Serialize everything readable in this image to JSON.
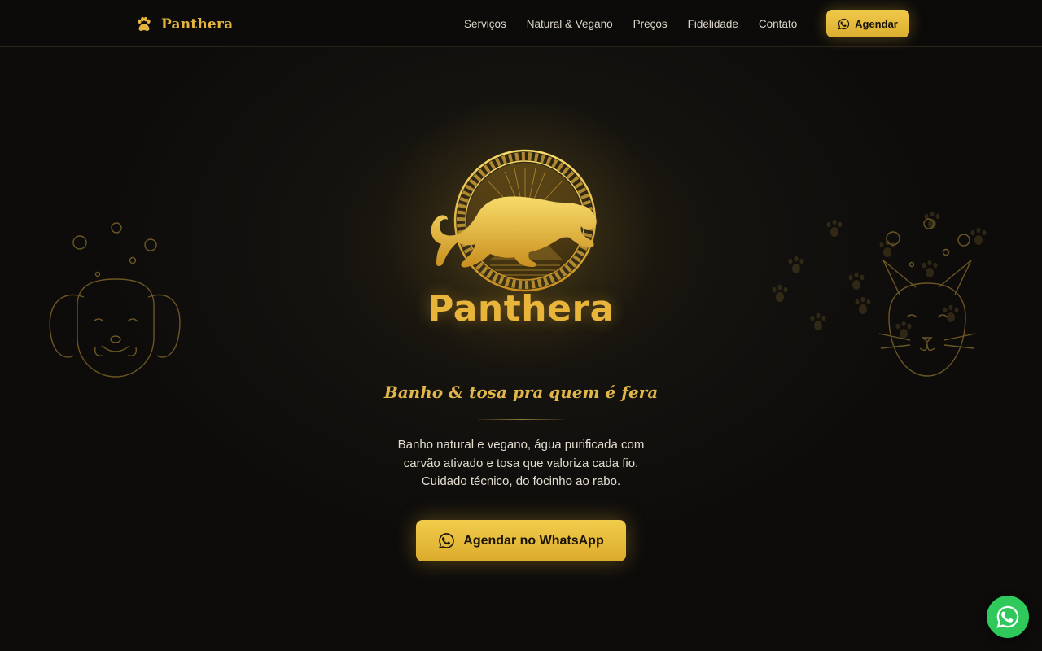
{
  "brand": {
    "name": "Panthera",
    "icon": "paw-icon"
  },
  "nav": {
    "links": [
      "Serviços",
      "Natural & Vegano",
      "Preços",
      "Fidelidade",
      "Contato"
    ],
    "cta_label": "Agendar",
    "cta_icon": "whatsapp-icon"
  },
  "hero": {
    "logo_wordmark": "Panthera",
    "tagline": "Banho & tosa pra quem é fera",
    "description_lines": [
      "Banho natural e vegano, água purificada com",
      "carvão ativado e tosa que valoriza cada fio.",
      "Cuidado técnico, do focinho ao rabo."
    ],
    "cta_label": "Agendar no WhatsApp",
    "cta_icon": "whatsapp-icon"
  },
  "floating_button": {
    "icon": "whatsapp-icon"
  },
  "colors": {
    "accent_gold": "#e3b53e",
    "background": "#0e0d0c",
    "whatsapp_green": "#2fc95b"
  }
}
